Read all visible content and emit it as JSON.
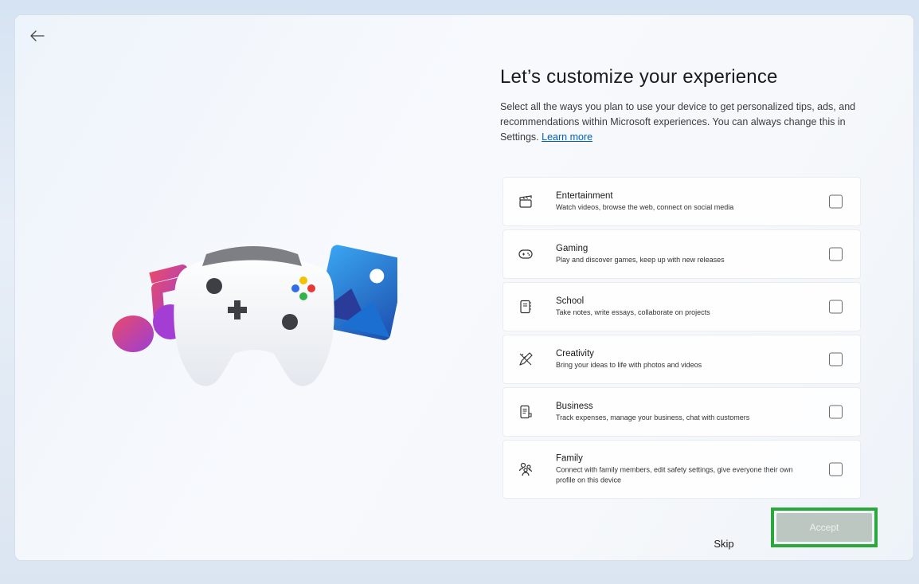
{
  "window": {
    "back_icon": "arrow-left-icon"
  },
  "header": {
    "title": "Let’s customize your experience",
    "description": "Select all the ways you plan to use your device to get personalized tips, ads, and recommendations within Microsoft experiences. You can always change this in Settings. ",
    "learn_more": "Learn more"
  },
  "options": [
    {
      "title": "Entertainment",
      "subtitle": "Watch videos, browse the web, connect on social media",
      "icon": "clapperboard-icon",
      "checked": false
    },
    {
      "title": "Gaming",
      "subtitle": "Play and discover games, keep up with new releases",
      "icon": "gamepad-icon",
      "checked": false
    },
    {
      "title": "School",
      "subtitle": "Take notes, write essays, collaborate on projects",
      "icon": "notebook-icon",
      "checked": false
    },
    {
      "title": "Creativity",
      "subtitle": "Bring your ideas to life with photos and videos",
      "icon": "pen-ruler-icon",
      "checked": false
    },
    {
      "title": "Business",
      "subtitle": "Track expenses, manage your business, chat with customers",
      "icon": "document-icon",
      "checked": false
    },
    {
      "title": "Family",
      "subtitle": "Connect with family members, edit safety settings, give everyone their own profile on this device",
      "icon": "people-icon",
      "checked": false
    }
  ],
  "footer": {
    "skip_label": "Skip",
    "accept_label": "Accept"
  },
  "colors": {
    "accent": "#005fb8",
    "highlight": "#2aa83a",
    "accept_disabled": "#bcc7c1"
  }
}
